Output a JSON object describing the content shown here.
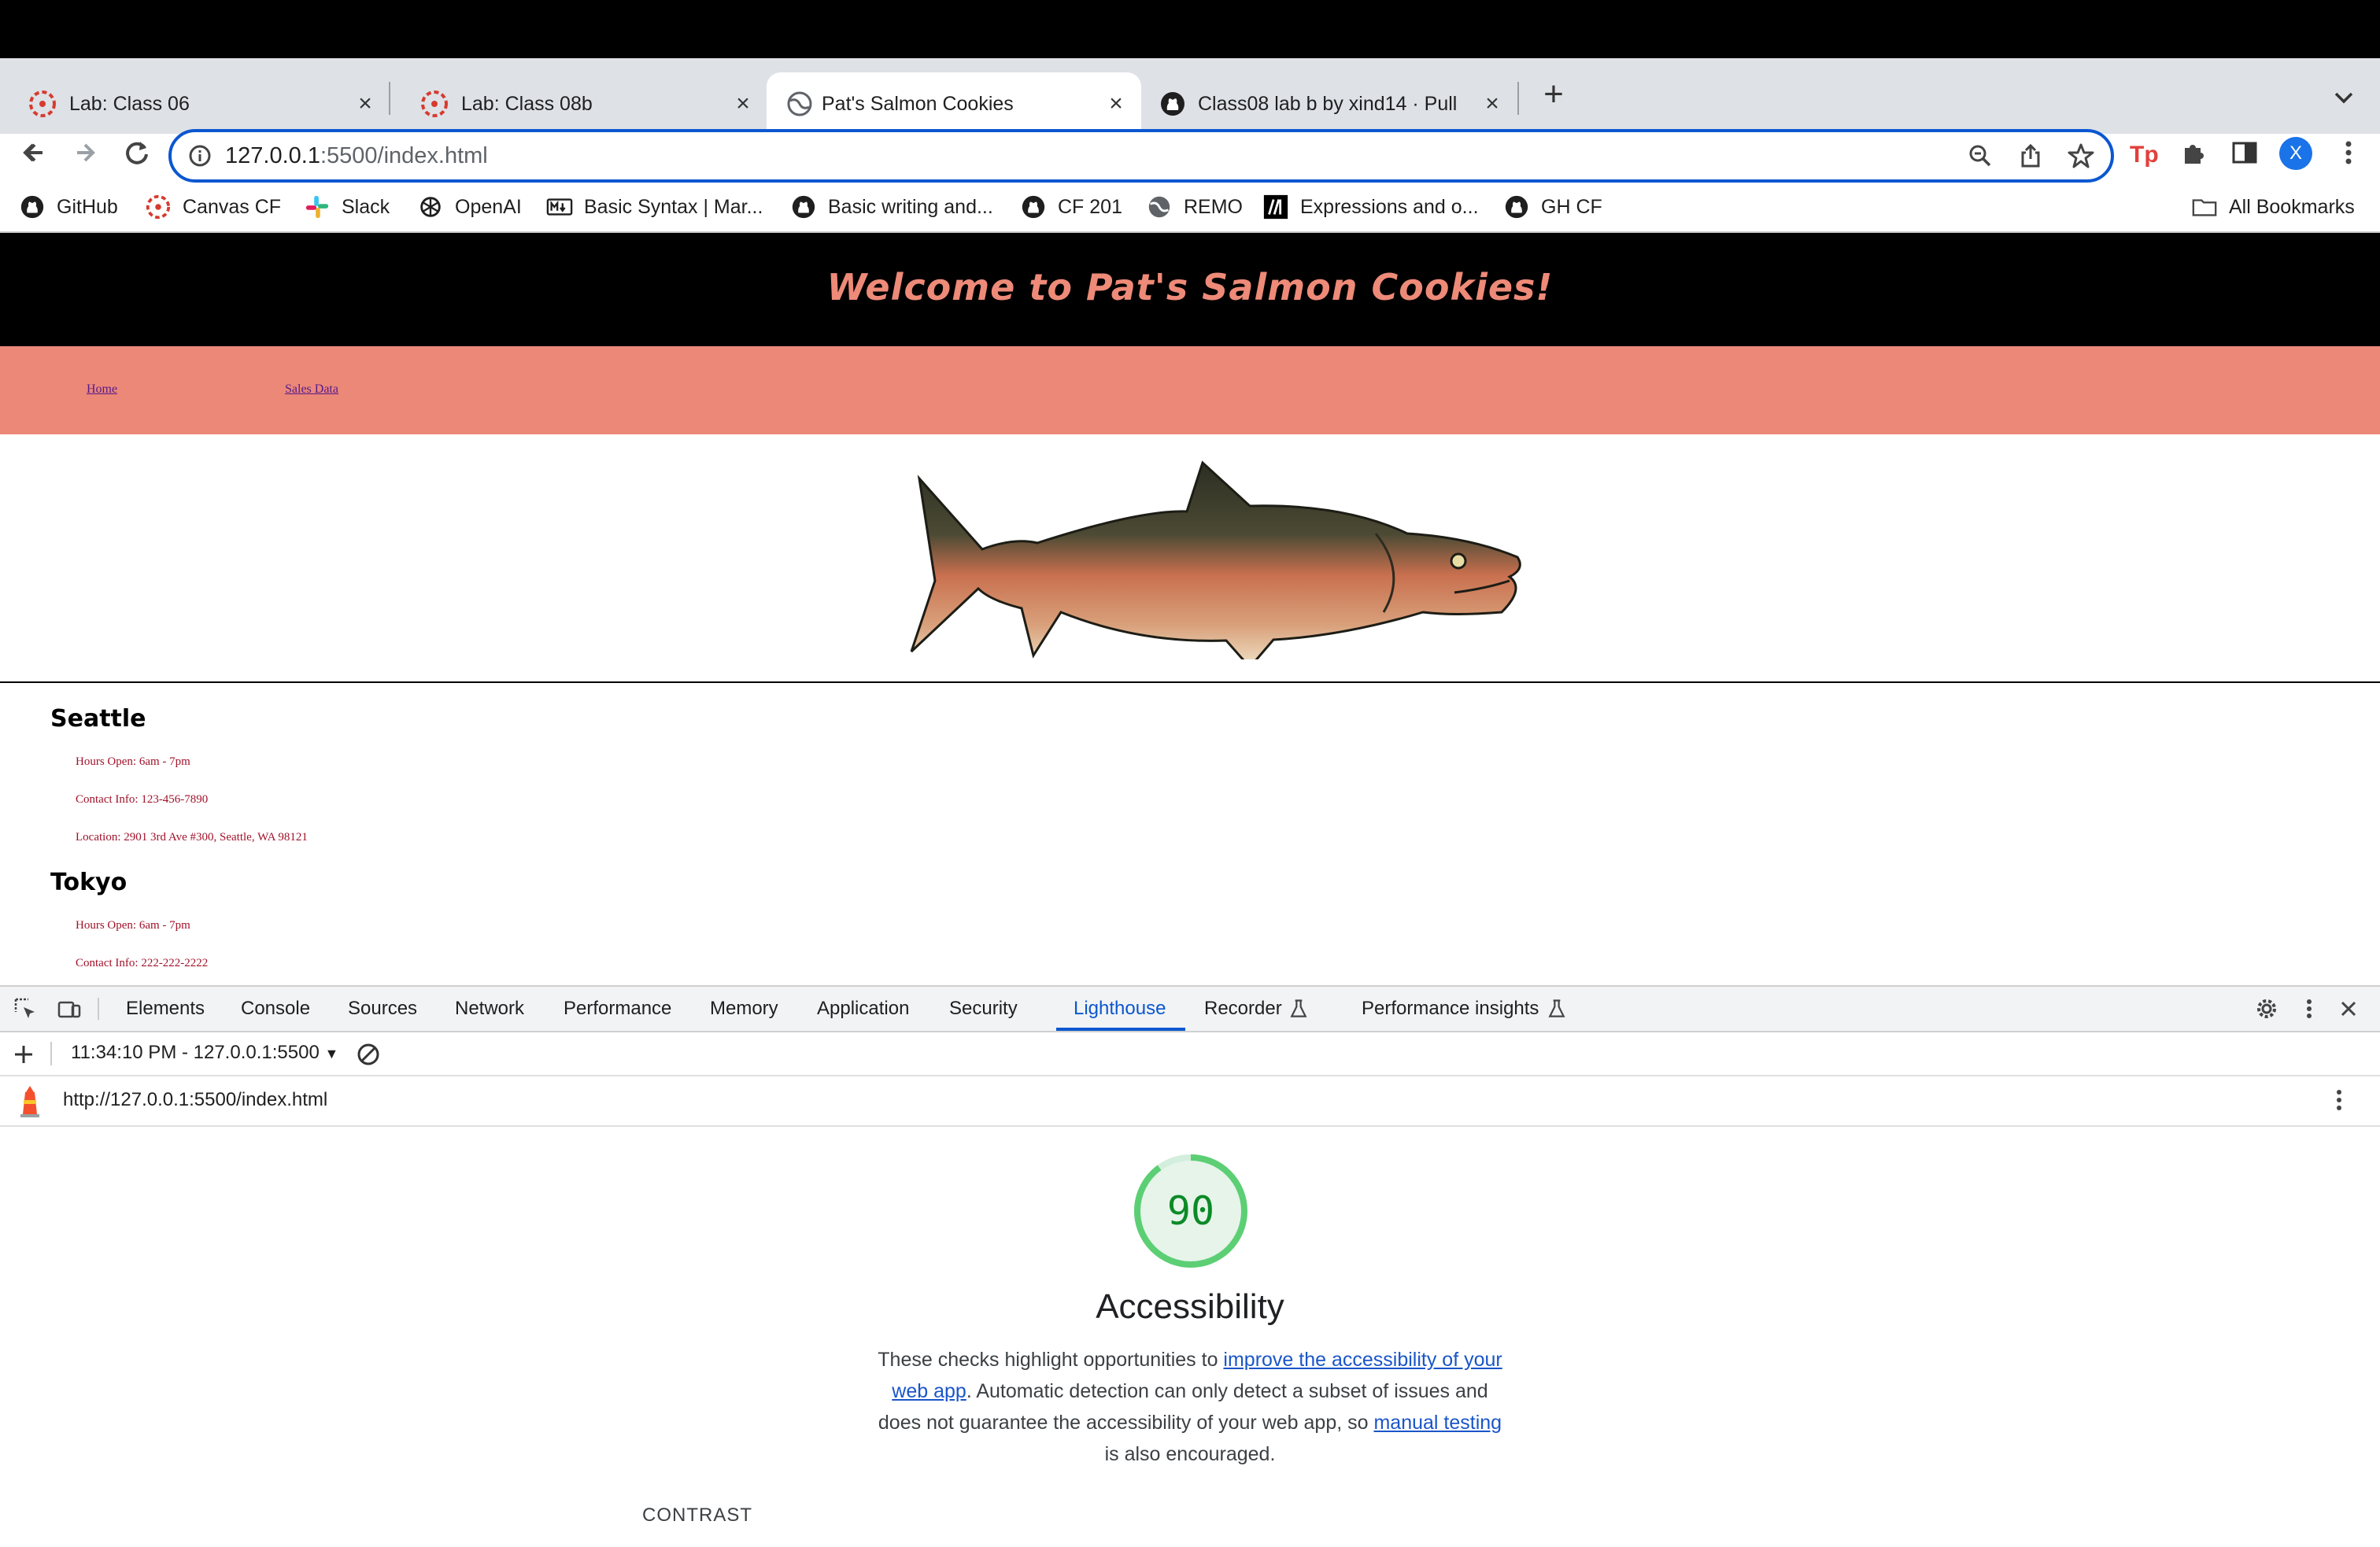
{
  "browser": {
    "tabs": [
      {
        "label": "Lab: Class 06",
        "icon": "canvas-logo-icon"
      },
      {
        "label": "Lab: Class 08b",
        "icon": "canvas-logo-icon"
      },
      {
        "label": "Pat's Salmon Cookies",
        "icon": "globe-icon",
        "active": true
      },
      {
        "label": "Class08 lab b by xind14 · Pull",
        "icon": "github-icon"
      }
    ],
    "new_tab": "+",
    "address": {
      "host": "127.0.0.1",
      "path": ":5500/index.html"
    },
    "profile_initial": "X",
    "bookmarks": [
      {
        "label": "GitHub",
        "icon": "github-icon"
      },
      {
        "label": "Canvas CF",
        "icon": "canvas-logo-icon"
      },
      {
        "label": "Slack",
        "icon": "slack-icon"
      },
      {
        "label": "OpenAI",
        "icon": "openai-icon"
      },
      {
        "label": "Basic Syntax | Mar...",
        "icon": "markdown-icon"
      },
      {
        "label": "Basic writing and...",
        "icon": "github-icon"
      },
      {
        "label": "CF 201",
        "icon": "github-icon"
      },
      {
        "label": "REMO",
        "icon": "globe-icon"
      },
      {
        "label": "Expressions and o...",
        "icon": "mdn-icon"
      },
      {
        "label": "GH CF",
        "icon": "github-icon"
      }
    ],
    "all_bookmarks": "All Bookmarks"
  },
  "page": {
    "title": "Welcome to Pat's Salmon Cookies!",
    "nav": {
      "home": "Home",
      "sales": "Sales Data"
    },
    "locations": [
      {
        "city": "Seattle",
        "hours": "Hours Open: 6am - 7pm",
        "contact": "Contact Info: 123-456-7890",
        "location": "Location: 2901 3rd Ave #300, Seattle, WA 98121"
      },
      {
        "city": "Tokyo",
        "hours": "Hours Open: 6am - 7pm",
        "contact": "Contact Info: 222-222-2222"
      }
    ]
  },
  "devtools": {
    "tabs": [
      "Elements",
      "Console",
      "Sources",
      "Network",
      "Performance",
      "Memory",
      "Application",
      "Security",
      "Lighthouse",
      "Recorder",
      "Performance insights"
    ],
    "active_tab": "Lighthouse",
    "report_select": "11:34:10 PM - 127.0.0.1:5500",
    "report_url": "http://127.0.0.1:5500/index.html",
    "score": 90,
    "score_color": "#0c8a27",
    "category_title": "Accessibility",
    "description": {
      "part1": "These checks highlight opportunities to ",
      "link1": "improve the accessibility of your web app",
      "part2": ". Automatic detection can only detect a subset of issues and does not guarantee the accessibility of your web app, so ",
      "link2": "manual testing",
      "part3": " is also encouraged."
    },
    "section_heading": "CONTRAST"
  }
}
